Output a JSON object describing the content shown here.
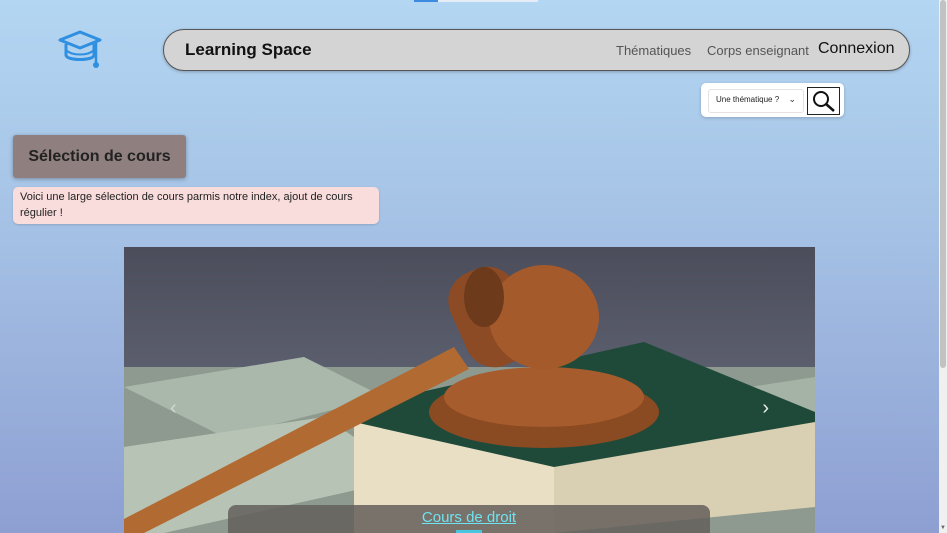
{
  "brand": "Learning Space",
  "nav": {
    "themes": "Thématiques",
    "teachers": "Corps enseignant",
    "login": "Connexion"
  },
  "search": {
    "select_value": "Une thématique ?",
    "chevron": "⌄"
  },
  "section": {
    "title": "Sélection de cours",
    "intro": "Voici une large sélection de cours parmis notre index, ajout de cours régulier !"
  },
  "carousel": {
    "caption": "Cours de droit",
    "prev": "‹",
    "next": "›"
  },
  "icons": {
    "logo": "graduation-cap-icon",
    "search": "magnifier-icon"
  },
  "colors": {
    "accent": "#3d8be0",
    "caption": "#6fe3f2",
    "title_box": "#8f7f7f",
    "intro_box": "#f9dcdc"
  }
}
